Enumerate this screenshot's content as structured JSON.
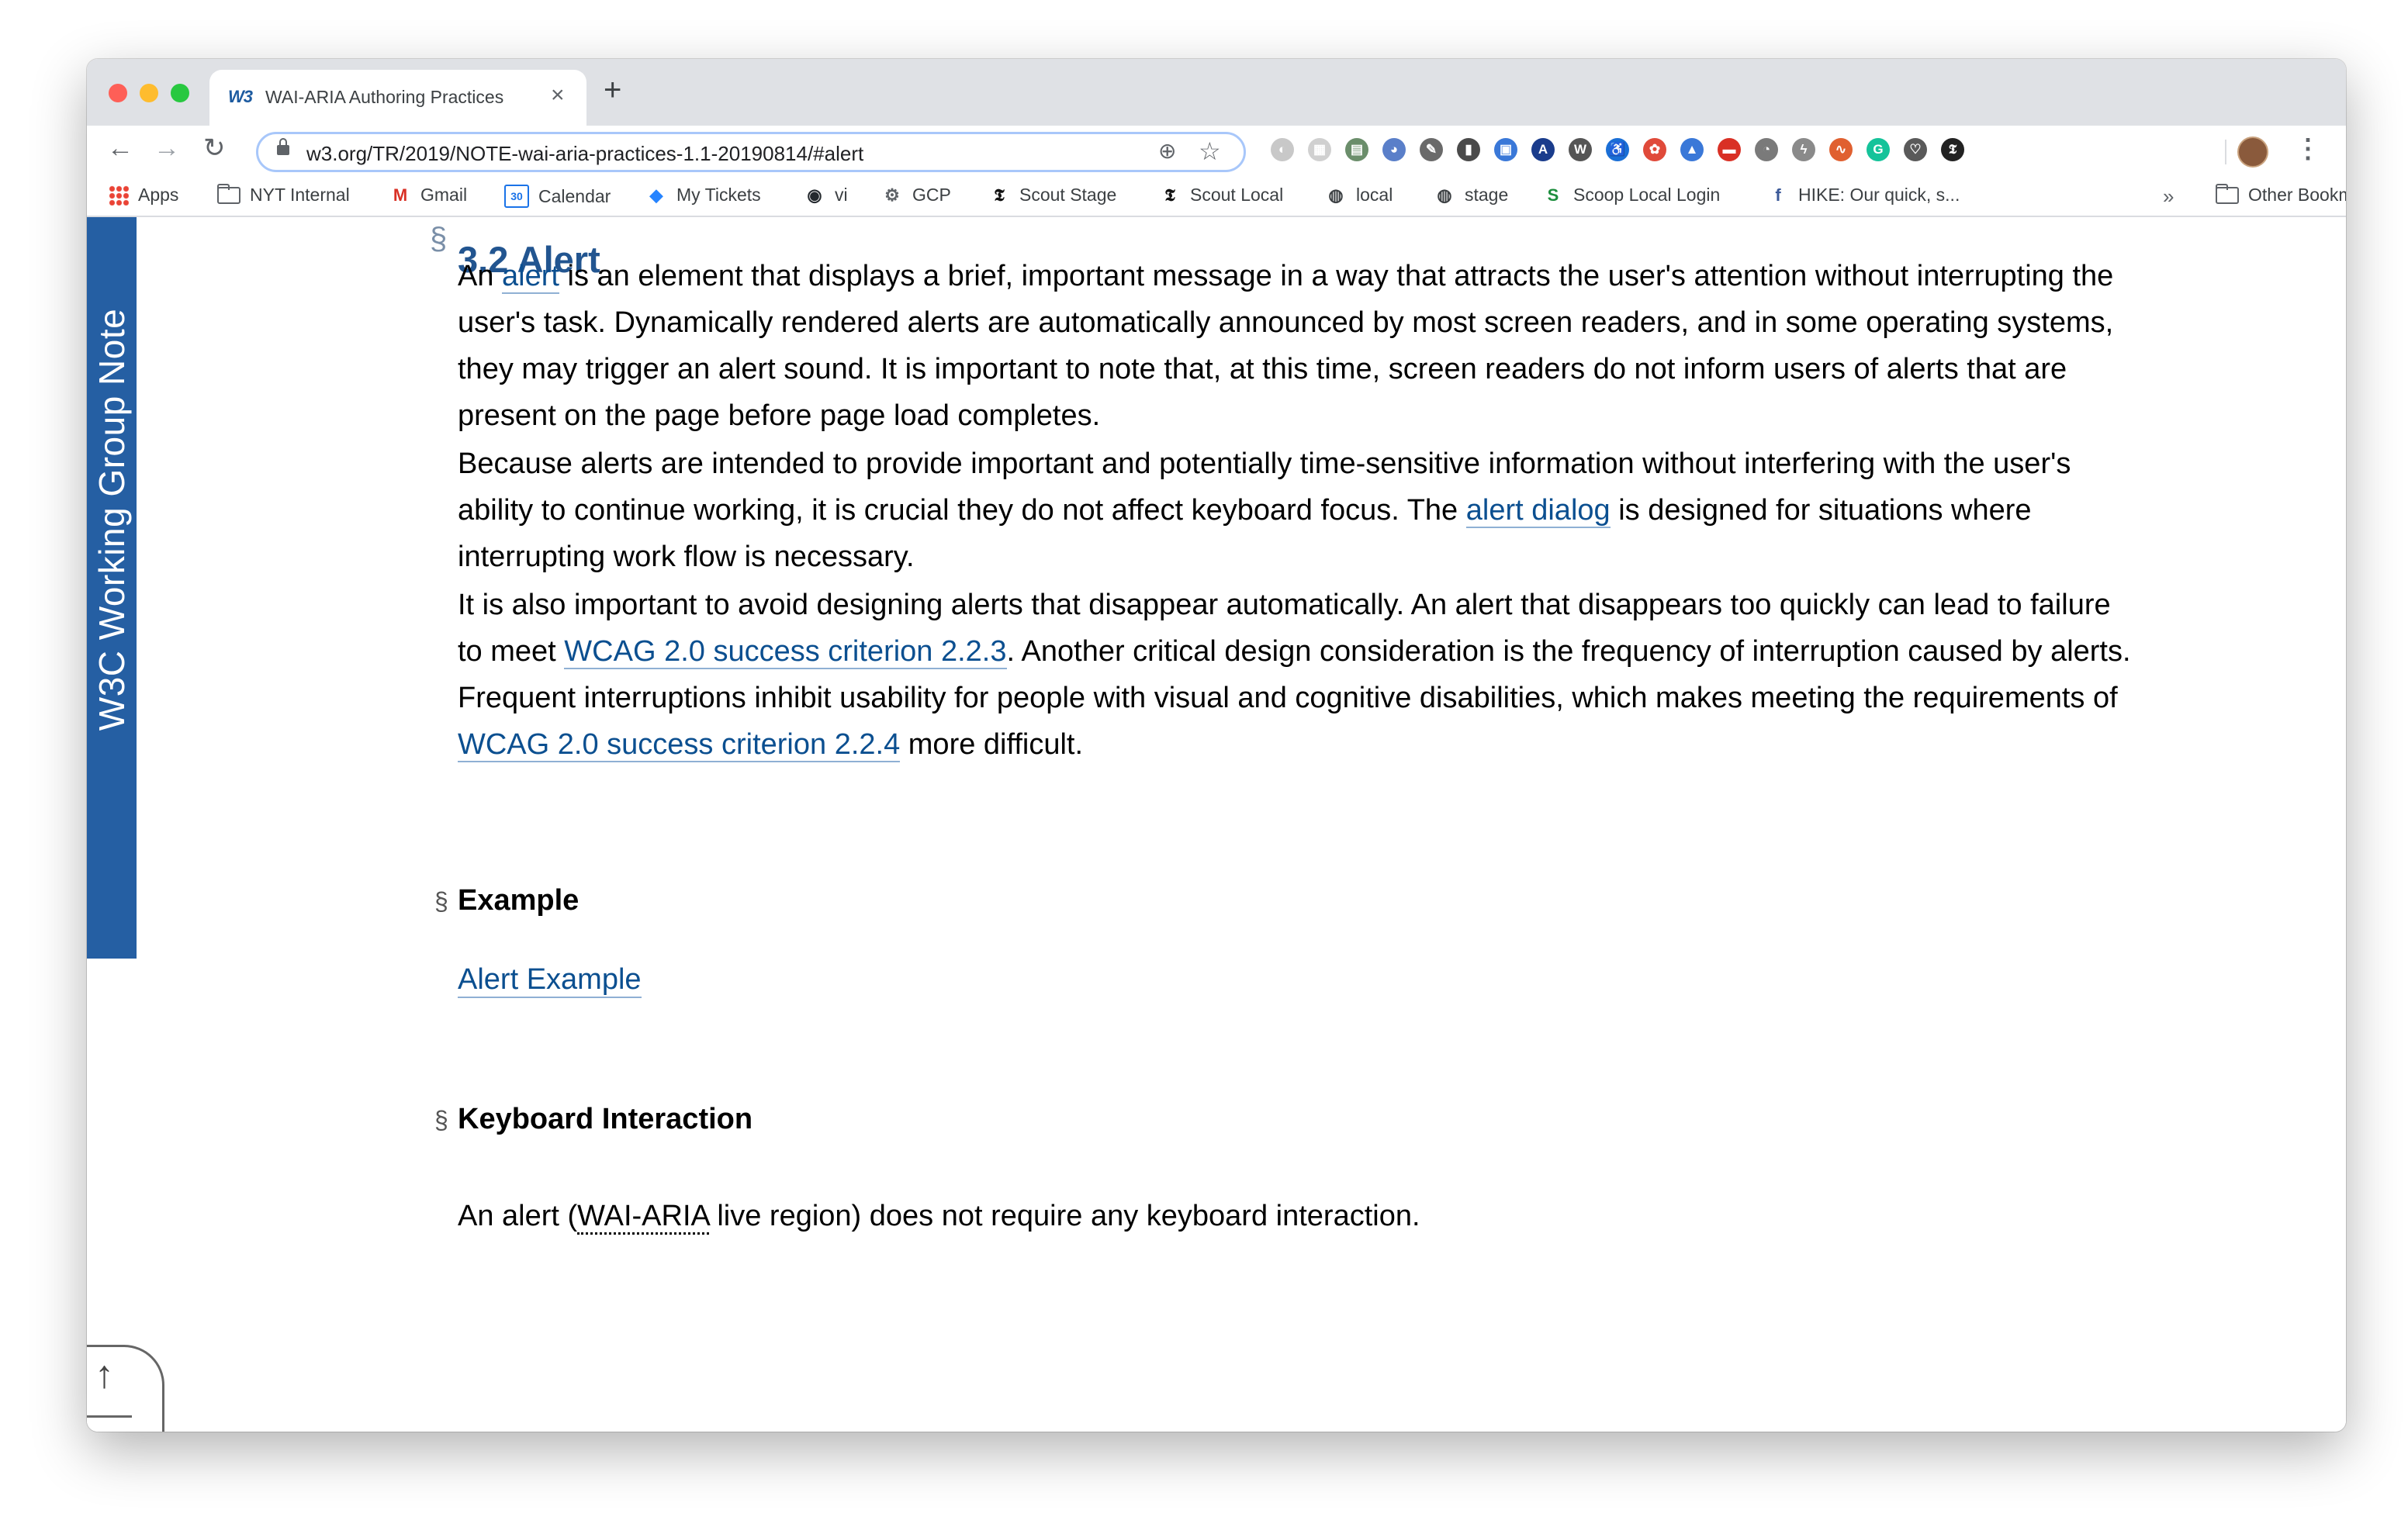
{
  "browser": {
    "tab_title": "WAI-ARIA Authoring Practices",
    "tab_favicon": "W3",
    "tab_close": "×",
    "new_tab": "+",
    "url": "w3.org/TR/2019/NOTE-wai-aria-practices-1.1-20190814/#alert",
    "nav": {
      "back": "←",
      "forward": "→",
      "reload": "↻"
    },
    "zoom_icon": "⊕",
    "star_icon": "☆",
    "menu": "⋮",
    "bookmark_overflow": "»",
    "extensions": [
      {
        "name": "ext-1-icon",
        "glyph": "◐",
        "color": "#c8c8c8"
      },
      {
        "name": "ext-2-icon",
        "glyph": "▦",
        "color": "#d0d0d0"
      },
      {
        "name": "ext-3-icon",
        "glyph": "▤",
        "color": "#6b8e6b"
      },
      {
        "name": "ext-4-icon",
        "glyph": "◕",
        "color": "#5a7fc9"
      },
      {
        "name": "ext-5-icon",
        "glyph": "✎",
        "color": "#6a6a6a"
      },
      {
        "name": "ext-6-icon",
        "glyph": "▮",
        "color": "#4a4a4a"
      },
      {
        "name": "ext-7-icon",
        "glyph": "▣",
        "color": "#3a78d8"
      },
      {
        "name": "ext-8-icon",
        "glyph": "A",
        "color": "#1a3c8c"
      },
      {
        "name": "ext-9-icon",
        "glyph": "W",
        "color": "#555555"
      },
      {
        "name": "ext-10-icon",
        "glyph": "♿",
        "color": "#1a6fd6"
      },
      {
        "name": "ext-11-icon",
        "glyph": "✿",
        "color": "#e04a3a"
      },
      {
        "name": "ext-12-icon",
        "glyph": "▲",
        "color": "#3a78d8"
      },
      {
        "name": "ext-13-icon",
        "glyph": "▬",
        "color": "#d93025"
      },
      {
        "name": "ext-14-icon",
        "glyph": "◔",
        "color": "#7a7a7a"
      },
      {
        "name": "ext-15-icon",
        "glyph": "ϟ",
        "color": "#8a8a8a"
      },
      {
        "name": "ext-16-icon",
        "glyph": "∿",
        "color": "#e06030"
      },
      {
        "name": "ext-17-icon",
        "glyph": "G",
        "color": "#15c39a"
      },
      {
        "name": "ext-18-icon",
        "glyph": "♡",
        "color": "#5a5a5a"
      },
      {
        "name": "ext-19-icon",
        "glyph": "𝕿",
        "color": "#222222"
      }
    ]
  },
  "bookmarks": [
    {
      "name": "bookmark-apps",
      "label": "Apps",
      "icon": "apps"
    },
    {
      "name": "bookmark-nyt-internal",
      "label": "NYT Internal",
      "icon": "folder"
    },
    {
      "name": "bookmark-gmail",
      "label": "Gmail",
      "icon": "M",
      "color": "#d93025"
    },
    {
      "name": "bookmark-calendar",
      "label": "Calendar",
      "icon": "30",
      "color": "#1a73e8"
    },
    {
      "name": "bookmark-my-tickets",
      "label": "My Tickets",
      "icon": "◆",
      "color": "#2684ff"
    },
    {
      "name": "bookmark-vi",
      "label": "vi",
      "icon": "◉",
      "color": "#24292e"
    },
    {
      "name": "bookmark-gcp",
      "label": "GCP",
      "icon": "⚙",
      "color": "#5f6368"
    },
    {
      "name": "bookmark-scout-stage",
      "label": "Scout Stage",
      "icon": "𝕿",
      "color": "#111111"
    },
    {
      "name": "bookmark-scout-local",
      "label": "Scout Local",
      "icon": "𝕿",
      "color": "#111111"
    },
    {
      "name": "bookmark-local",
      "label": "local",
      "icon": "◍",
      "color": "#3c4043"
    },
    {
      "name": "bookmark-stage",
      "label": "stage",
      "icon": "◍",
      "color": "#3c4043"
    },
    {
      "name": "bookmark-scoop-local-login",
      "label": "Scoop Local Login",
      "icon": "S",
      "color": "#1e8e3e"
    },
    {
      "name": "bookmark-hike",
      "label": "HIKE: Our quick, s...",
      "icon": "f",
      "color": "#3b5998"
    }
  ],
  "other_bookmarks": "Other Bookmarks",
  "sidebar_label": "W3C Working Group Note",
  "content": {
    "section_mark": "§",
    "heading": "3.2 Alert",
    "p1": {
      "a": "An ",
      "link": "alert",
      "b": " is an element that displays a brief, important message in a way that attracts the user's attention without interrupting the user's task. Dynamically rendered alerts are automatically announced by most screen readers, and in some operating systems, they may trigger an alert sound. It is important to note that, at this time, screen readers do not inform users of alerts that are present on the page before page load completes."
    },
    "p2": {
      "a": "Because alerts are intended to provide important and potentially time-sensitive information without interfering with the user's ability to continue working, it is crucial they do not affect keyboard focus. The ",
      "link": "alert dialog",
      "b": " is designed for situations where interrupting work flow is necessary."
    },
    "p3": {
      "a": "It is also important to avoid designing alerts that disappear automatically. An alert that disappears too quickly can lead to failure to meet ",
      "link1": "WCAG 2.0 success criterion 2.2.3",
      "b": ". Another critical design consideration is the frequency of interruption caused by alerts. Frequent interruptions inhibit usability for people with visual and cognitive disabilities, which makes meeting the requirements of ",
      "link2": "WCAG 2.0 success criterion 2.2.4",
      "c": " more difficult."
    },
    "example_heading": "Example",
    "example_link": "Alert Example",
    "keyboard_heading": "Keyboard Interaction",
    "keyboard_text": {
      "a": "An alert (",
      "abbr": "WAI-ARIA",
      "b": " live region) does not require any keyboard interaction."
    }
  },
  "scroll_widget": {
    "up": "↑",
    "right": "→"
  }
}
